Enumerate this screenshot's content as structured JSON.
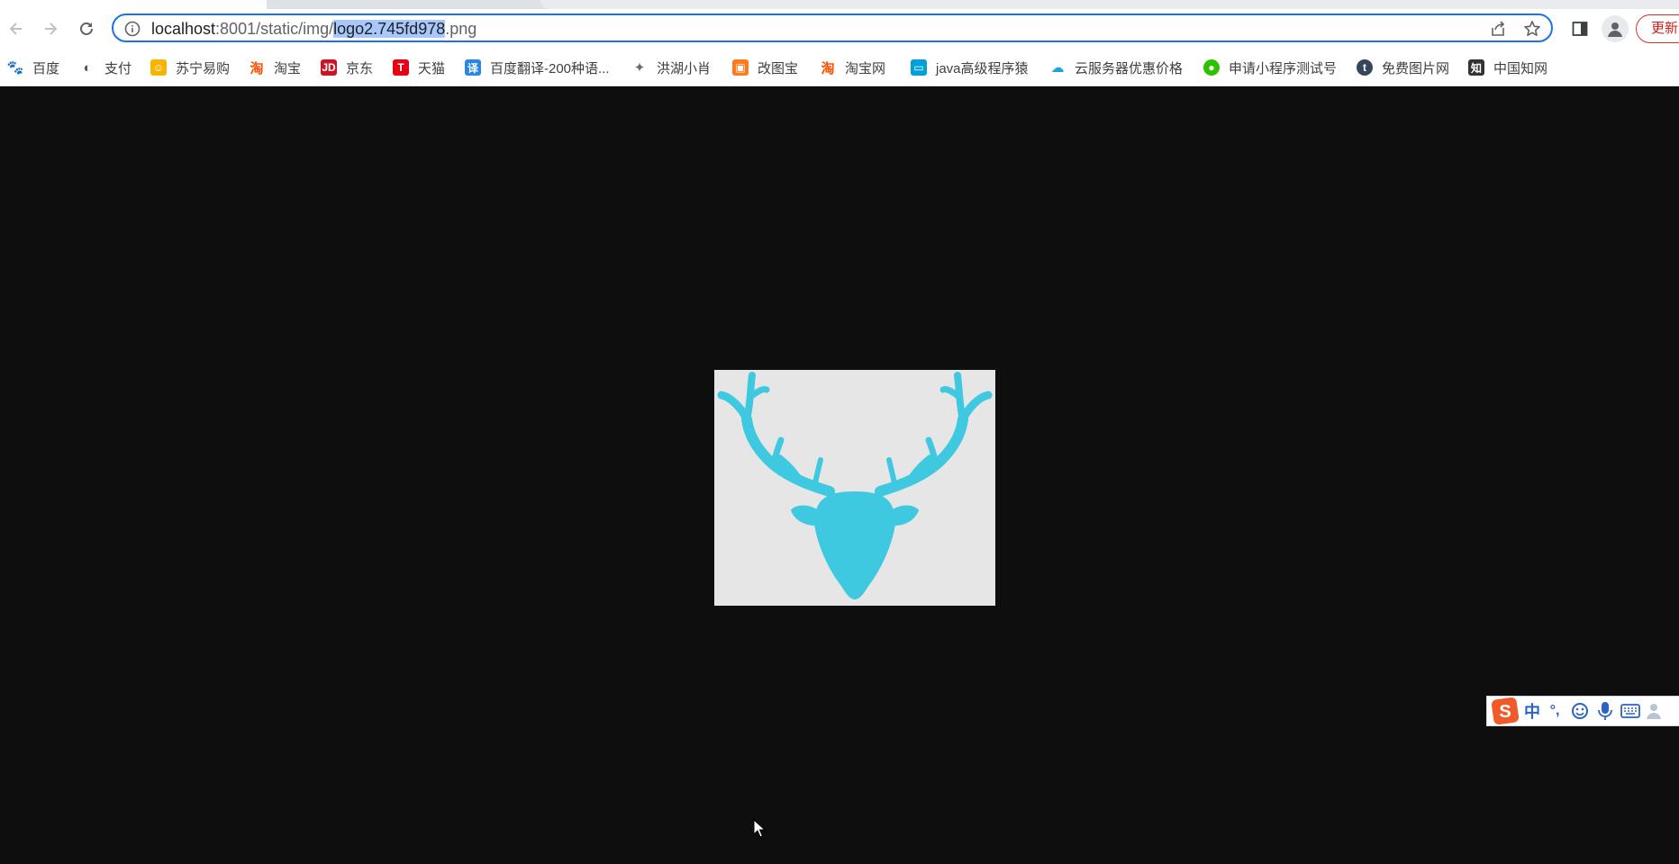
{
  "browser": {
    "url": {
      "host": "localhost",
      "rest_before_selection": ":8001/static/img/",
      "selected": "logo2.745fd978",
      "rest_after_selection": ".png"
    },
    "update_button_label": "更新"
  },
  "bookmarks": [
    {
      "label": "百度",
      "icon": "baidu-paw-icon",
      "color": "#2932e1"
    },
    {
      "label": "支付",
      "icon": "globe-icon",
      "color": "#555555"
    },
    {
      "label": "苏宁易购",
      "icon": "suning-icon",
      "color": "#f7b500"
    },
    {
      "label": "淘宝",
      "icon": "taobao-icon",
      "color": "#ff5000"
    },
    {
      "label": "京东",
      "icon": "jd-icon",
      "color": "#c91623"
    },
    {
      "label": "天猫",
      "icon": "tmall-icon",
      "color": "#e60012"
    },
    {
      "label": "百度翻译-200种语...",
      "icon": "translate-icon",
      "color": "#2b85e4"
    },
    {
      "label": "洪湖小肖",
      "icon": "bird-icon",
      "color": "#6b6b6b"
    },
    {
      "label": "改图宝",
      "icon": "gaitubao-icon",
      "color": "#ff7a1a"
    },
    {
      "label": "淘宝网",
      "icon": "taobao-icon",
      "color": "#ff5000"
    },
    {
      "label": "java高级程序猿",
      "icon": "bilibili-icon",
      "color": "#00a1d6"
    },
    {
      "label": "云服务器优惠价格",
      "icon": "cloud-icon",
      "color": "#1aa3d9"
    },
    {
      "label": "申请小程序测试号",
      "icon": "wechat-icon",
      "color": "#2dc100"
    },
    {
      "label": "免费图片网",
      "icon": "tumblr-icon",
      "color": "#35465c"
    },
    {
      "label": "中国知网",
      "icon": "cnki-icon",
      "color": "#333333"
    }
  ],
  "image": {
    "description_icon": "deer-antlers-logo",
    "background_color": "#e6e6e6",
    "logo_color": "#3fc9e0"
  },
  "ime": {
    "mode_label": "中",
    "punct_label": "°,"
  }
}
